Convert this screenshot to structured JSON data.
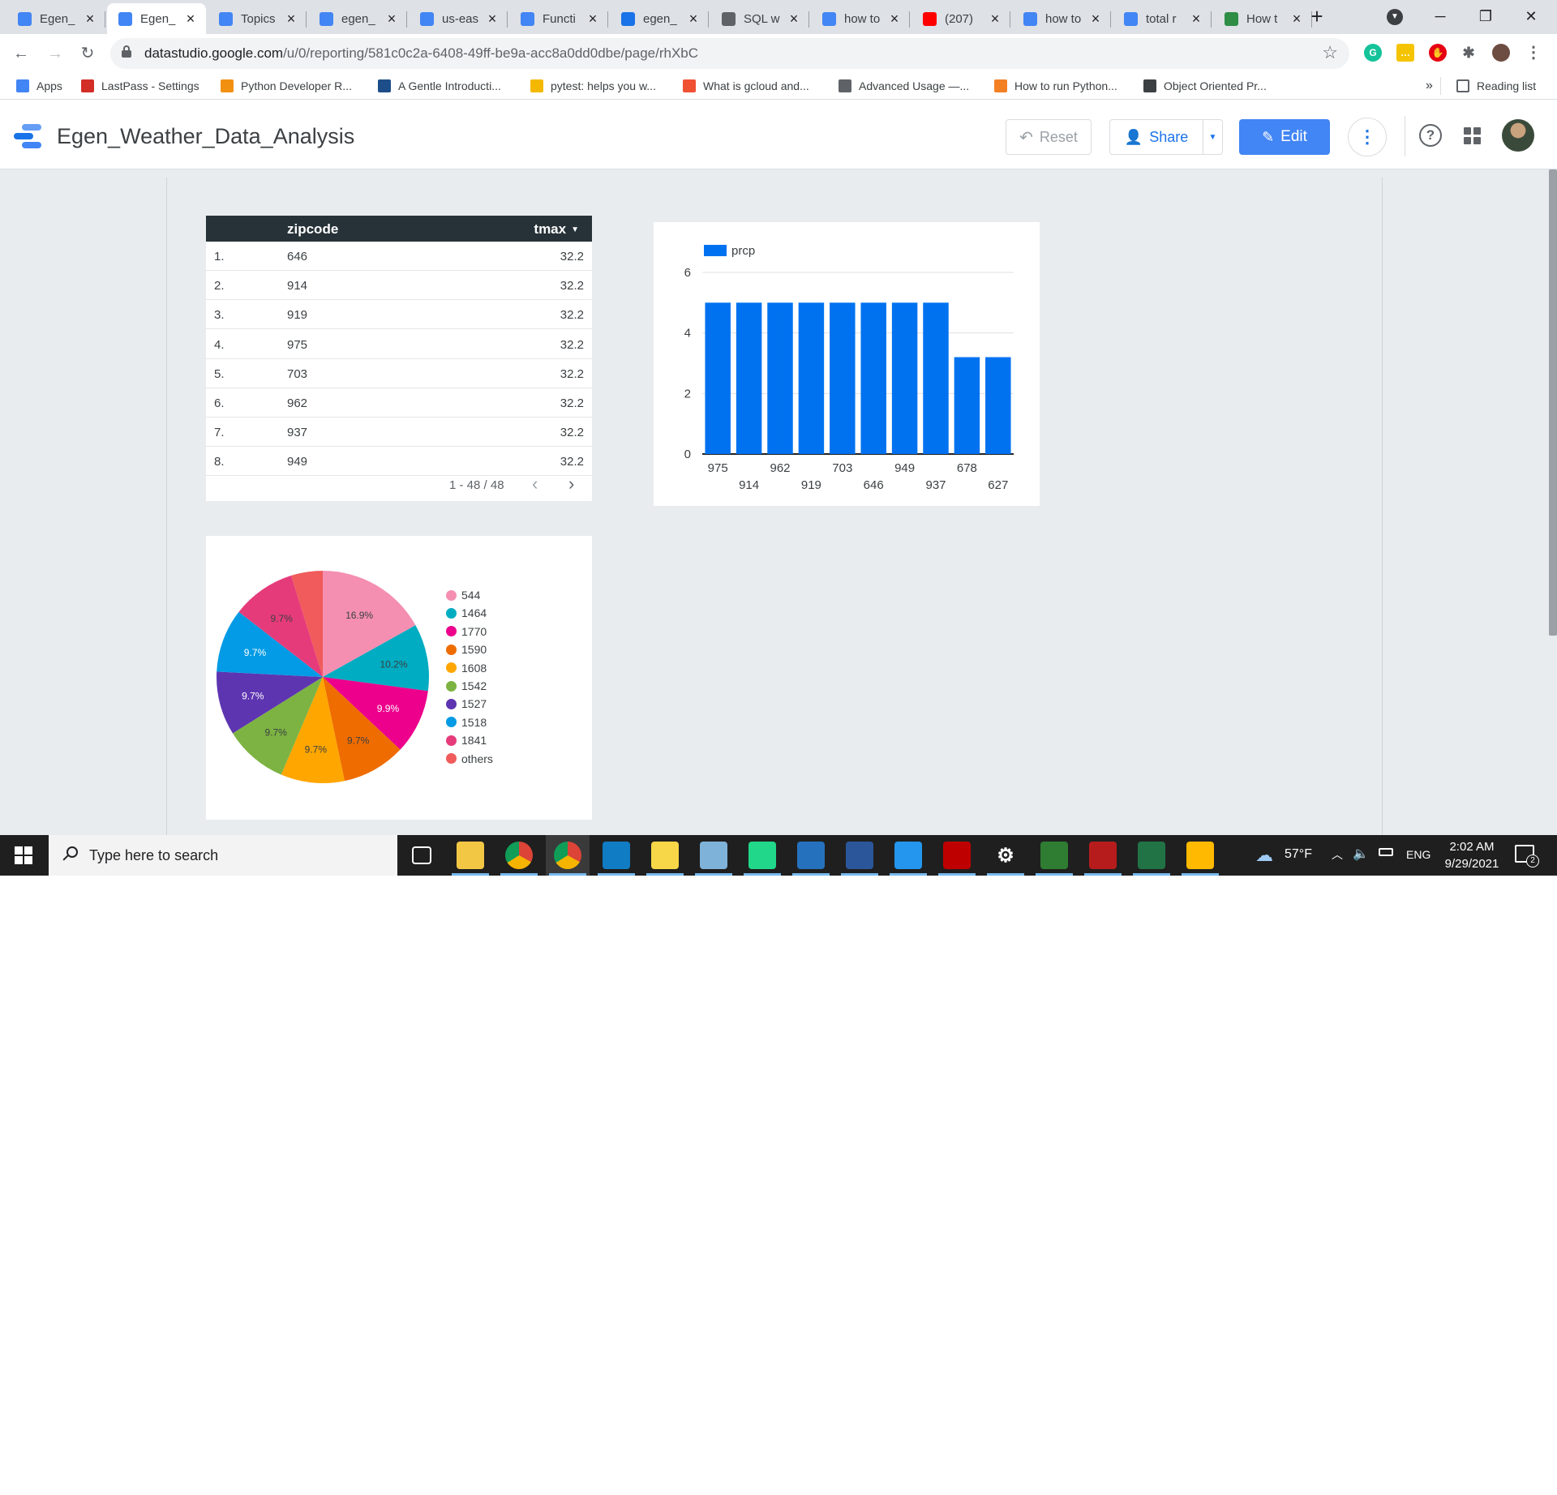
{
  "browser": {
    "tabs": [
      {
        "title": "Egen_",
        "icon": "data-studio-icon",
        "color": "#4285f4"
      },
      {
        "title": "Egen_",
        "icon": "data-studio-icon",
        "color": "#4285f4",
        "active": true
      },
      {
        "title": "Topics",
        "icon": "pubsub-icon",
        "color": "#4285f4"
      },
      {
        "title": "egen_",
        "icon": "bigquery-icon",
        "color": "#4285f4"
      },
      {
        "title": "us-eas",
        "icon": "bigquery-icon",
        "color": "#4285f4"
      },
      {
        "title": "Functi",
        "icon": "cloud-functions-icon",
        "color": "#4285f4"
      },
      {
        "title": "egen_",
        "icon": "dataflow-icon",
        "color": "#1a73e8"
      },
      {
        "title": "SQL w",
        "icon": "sql-icon",
        "color": "#5f6368"
      },
      {
        "title": "how to",
        "icon": "google-icon",
        "color": "#4285f4"
      },
      {
        "title": "(207)",
        "icon": "youtube-icon",
        "color": "#ff0000"
      },
      {
        "title": "how to",
        "icon": "google-icon",
        "color": "#4285f4"
      },
      {
        "title": "total r",
        "icon": "google-icon",
        "color": "#4285f4"
      },
      {
        "title": "How t",
        "icon": "geeksforgeeks-icon",
        "color": "#2f8d46"
      }
    ],
    "url_host": "datastudio.google.com",
    "url_path": "/u/0/reporting/581c0c2a-6408-49ff-be9a-acc8a0dd0dbe/page/rhXbC",
    "bookmarks": [
      {
        "label": "Apps",
        "color": "#4285f4"
      },
      {
        "label": "LastPass - Settings",
        "color": "#d32d27"
      },
      {
        "label": "Python Developer R...",
        "color": "#f29111"
      },
      {
        "label": "A Gentle Introducti...",
        "color": "#1d4e89"
      },
      {
        "label": "pytest: helps you w...",
        "color": "#f5b800"
      },
      {
        "label": "What is gcloud and...",
        "color": "#f05133"
      },
      {
        "label": "Advanced Usage —...",
        "color": "#5f6368"
      },
      {
        "label": "How to run Python...",
        "color": "#f48024"
      },
      {
        "label": "Object Oriented Pr...",
        "color": "#3c4043"
      }
    ],
    "bookmarks_overflow": "»",
    "reading_list": "Reading list"
  },
  "header": {
    "title": "Egen_Weather_Data_Analysis",
    "reset_label": "Reset",
    "share_label": "Share",
    "edit_label": "Edit"
  },
  "table": {
    "columns": [
      "zipcode",
      "tmax"
    ],
    "rows": [
      {
        "n": "1.",
        "zipcode": "646",
        "tmax": "32.2"
      },
      {
        "n": "2.",
        "zipcode": "914",
        "tmax": "32.2"
      },
      {
        "n": "3.",
        "zipcode": "919",
        "tmax": "32.2"
      },
      {
        "n": "4.",
        "zipcode": "975",
        "tmax": "32.2"
      },
      {
        "n": "5.",
        "zipcode": "703",
        "tmax": "32.2"
      },
      {
        "n": "6.",
        "zipcode": "962",
        "tmax": "32.2"
      },
      {
        "n": "7.",
        "zipcode": "937",
        "tmax": "32.2"
      },
      {
        "n": "8.",
        "zipcode": "949",
        "tmax": "32.2"
      }
    ],
    "pagination": "1 - 48 / 48"
  },
  "chart_data": [
    {
      "type": "bar",
      "categories": [
        "975",
        "914",
        "962",
        "919",
        "703",
        "646",
        "949",
        "937",
        "678",
        "627"
      ],
      "series": [
        {
          "name": "prcp",
          "values": [
            5,
            5,
            5,
            5,
            5,
            5,
            5,
            5,
            3.2,
            3.2
          ],
          "color": "#0072f0"
        }
      ],
      "yticks": [
        0,
        2,
        4,
        6
      ],
      "ylim": [
        0,
        6
      ],
      "legend": "top-left",
      "grid": true
    },
    {
      "type": "pie",
      "slices": [
        {
          "label": "544",
          "value": 16.9,
          "text": "16.9%",
          "color": "#f48fb1"
        },
        {
          "label": "1464",
          "value": 10.2,
          "text": "10.2%",
          "color": "#00acc1"
        },
        {
          "label": "1770",
          "value": 9.9,
          "text": "9.9%",
          "color": "#ec008c"
        },
        {
          "label": "1590",
          "value": 9.7,
          "text": "9.7%",
          "color": "#ef6c00"
        },
        {
          "label": "1608",
          "value": 9.7,
          "text": "9.7%",
          "color": "#ffa600"
        },
        {
          "label": "1542",
          "value": 9.7,
          "text": "9.7%",
          "color": "#7cb342"
        },
        {
          "label": "1527",
          "value": 9.7,
          "text": "9.7%",
          "color": "#5e35b1"
        },
        {
          "label": "1518",
          "value": 9.7,
          "text": "9.7%",
          "color": "#039be5"
        },
        {
          "label": "1841",
          "value": 9.7,
          "text": "9.7%",
          "color": "#e63b7a"
        },
        {
          "label": "others",
          "value": 4.8,
          "text": "",
          "color": "#f15b5b"
        }
      ],
      "legend": "right"
    }
  ],
  "taskbar": {
    "search_placeholder": "Type here to search",
    "apps": [
      {
        "name": "task-view-icon",
        "color": "#1f1f1f"
      },
      {
        "name": "file-explorer-icon",
        "color": "#f2c744"
      },
      {
        "name": "chrome-icon",
        "color": "#db4437"
      },
      {
        "name": "chrome-icon",
        "color": "#4285f4"
      },
      {
        "name": "edge-icon",
        "color": "#0f7cc4"
      },
      {
        "name": "sticky-notes-icon",
        "color": "#f7d747"
      },
      {
        "name": "paint-icon",
        "color": "#7fb2d9"
      },
      {
        "name": "pycharm-icon",
        "color": "#21d789"
      },
      {
        "name": "powershell-icon",
        "color": "#2671be"
      },
      {
        "name": "word-icon",
        "color": "#2b579a"
      },
      {
        "name": "docker-icon",
        "color": "#2496ed"
      },
      {
        "name": "filezilla-icon",
        "color": "#bf0000"
      },
      {
        "name": "settings-icon",
        "color": "#1f1f1f"
      },
      {
        "name": "spinner-app-icon",
        "color": "#2e7d32"
      },
      {
        "name": "network-app-icon",
        "color": "#b71c1c"
      },
      {
        "name": "excel-icon",
        "color": "#217346"
      },
      {
        "name": "paint-3d-icon",
        "color": "#ffb900"
      }
    ],
    "weather": "57°F",
    "language": "ENG",
    "time": "2:02 AM",
    "date": "9/29/2021",
    "notification_count": "2"
  }
}
